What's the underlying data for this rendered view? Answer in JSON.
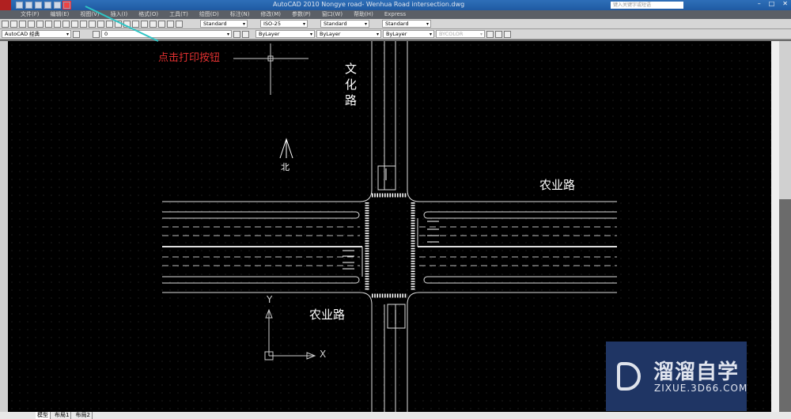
{
  "title": "AutoCAD 2010    Nongye road- Wenhua Road intersection.dwg",
  "search_placeholder": "键入关键字或短语",
  "menu": [
    "文件(F)",
    "编辑(E)",
    "视图(V)",
    "插入(I)",
    "格式(O)",
    "工具(T)",
    "绘图(D)",
    "标注(N)",
    "修改(M)",
    "参数(P)",
    "窗口(W)",
    "帮助(H)",
    "Express"
  ],
  "toolbar": {
    "text_style": "Standard",
    "dim_style": "ISO-25",
    "table_style": "Standard",
    "mleader_style": "Standard",
    "workspace": "AutoCAD 经典",
    "layer": "0",
    "color": "ByLayer",
    "linetype": "ByLayer",
    "lineweight": "ByLayer",
    "plotstyle": "BYCOLOR"
  },
  "annotation": "点击打印按钮",
  "drawing": {
    "road_vertical": [
      "文",
      "化",
      "路"
    ],
    "road_horizontal_1": "农业路",
    "road_horizontal_2": "农业路",
    "north": "北",
    "ucs_x": "X",
    "ucs_y": "Y"
  },
  "tabs": [
    "模型",
    "布局1",
    "布局2"
  ],
  "watermark": {
    "name": "溜溜自学",
    "url": "ZIXUE.3D66.COM"
  },
  "window_controls": [
    "–",
    "□",
    "✕"
  ]
}
